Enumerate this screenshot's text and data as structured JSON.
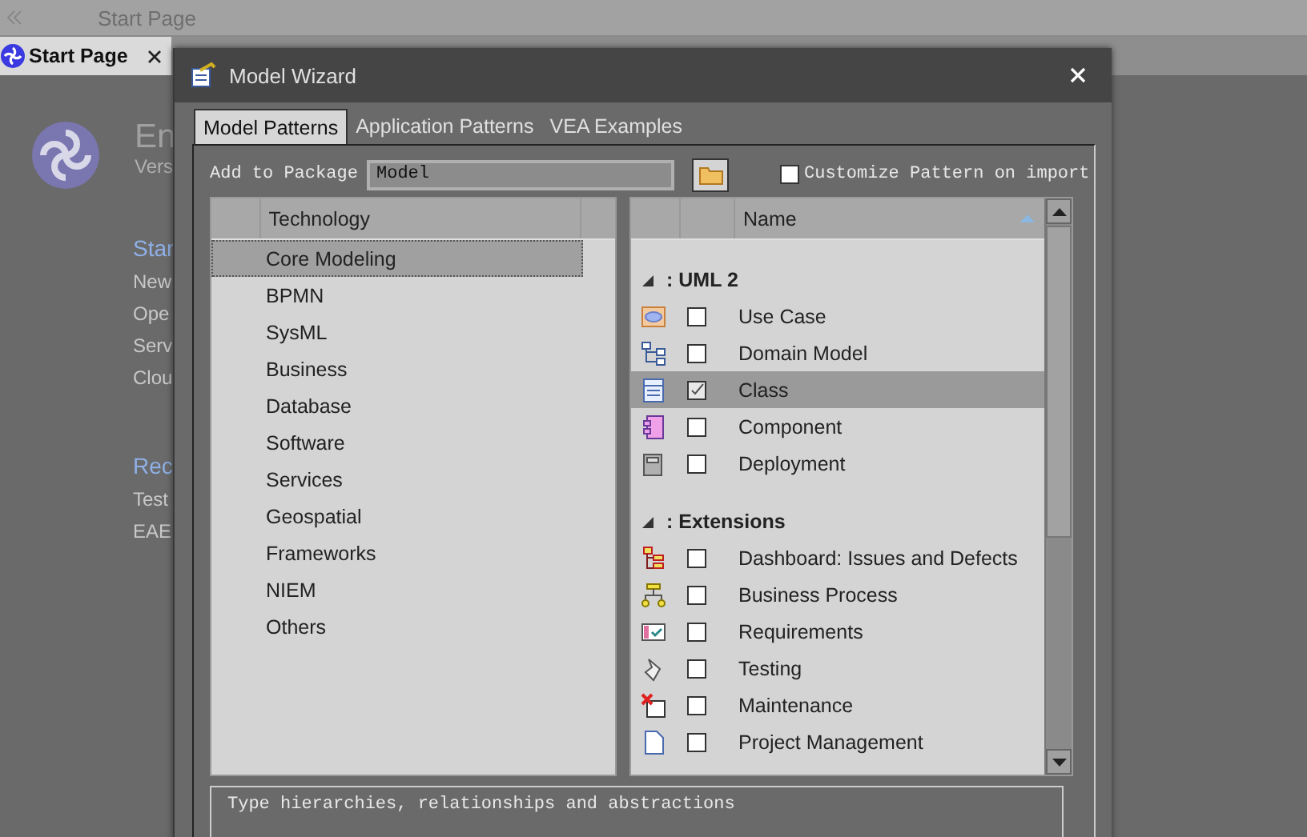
{
  "top_bar": {
    "title": "Start Page"
  },
  "document_tab": {
    "label": "Start Page",
    "selected": true
  },
  "start_page": {
    "product_title": "En",
    "version": "Vers",
    "sections": [
      {
        "heading": "Star",
        "links": [
          "New",
          "Ope",
          "Serv",
          "Clou"
        ]
      },
      {
        "heading": "Rec",
        "links": [
          "Test",
          "EAE"
        ]
      }
    ]
  },
  "dialog": {
    "title": "Model Wizard",
    "tabs": [
      {
        "label": "Model Patterns",
        "selected": true
      },
      {
        "label": "Application Patterns",
        "selected": false
      },
      {
        "label": "VEA Examples",
        "selected": false
      }
    ],
    "add_to_package": {
      "label": "Add to Package",
      "value": "Model"
    },
    "customize": {
      "label": "Customize Pattern on import",
      "checked": false
    },
    "technologies": {
      "column": "Technology",
      "items": [
        {
          "label": "Core Modeling",
          "selected": true
        },
        {
          "label": "BPMN",
          "selected": false
        },
        {
          "label": "SysML",
          "selected": false
        },
        {
          "label": "Business",
          "selected": false
        },
        {
          "label": "Database",
          "selected": false
        },
        {
          "label": "Software",
          "selected": false
        },
        {
          "label": "Services",
          "selected": false
        },
        {
          "label": "Geospatial",
          "selected": false
        },
        {
          "label": "Frameworks",
          "selected": false
        },
        {
          "label": "NIEM",
          "selected": false
        },
        {
          "label": "Others",
          "selected": false
        }
      ]
    },
    "patterns": {
      "column": "Name",
      "groups": [
        {
          "label": ": UML 2",
          "expanded": true,
          "items": [
            {
              "label": "Use Case",
              "checked": false,
              "selected": false
            },
            {
              "label": "Domain Model",
              "checked": false,
              "selected": false
            },
            {
              "label": "Class",
              "checked": true,
              "selected": true
            },
            {
              "label": "Component",
              "checked": false,
              "selected": false
            },
            {
              "label": "Deployment",
              "checked": false,
              "selected": false
            }
          ]
        },
        {
          "label": ": Extensions",
          "expanded": true,
          "items": [
            {
              "label": "Dashboard: Issues and Defects",
              "checked": false,
              "selected": false
            },
            {
              "label": "Business Process",
              "checked": false,
              "selected": false
            },
            {
              "label": "Requirements",
              "checked": false,
              "selected": false
            },
            {
              "label": "Testing",
              "checked": false,
              "selected": false
            },
            {
              "label": "Maintenance",
              "checked": false,
              "selected": false
            },
            {
              "label": "Project Management",
              "checked": false,
              "selected": false
            }
          ]
        }
      ]
    },
    "description": "Type hierarchies, relationships and abstractions"
  }
}
